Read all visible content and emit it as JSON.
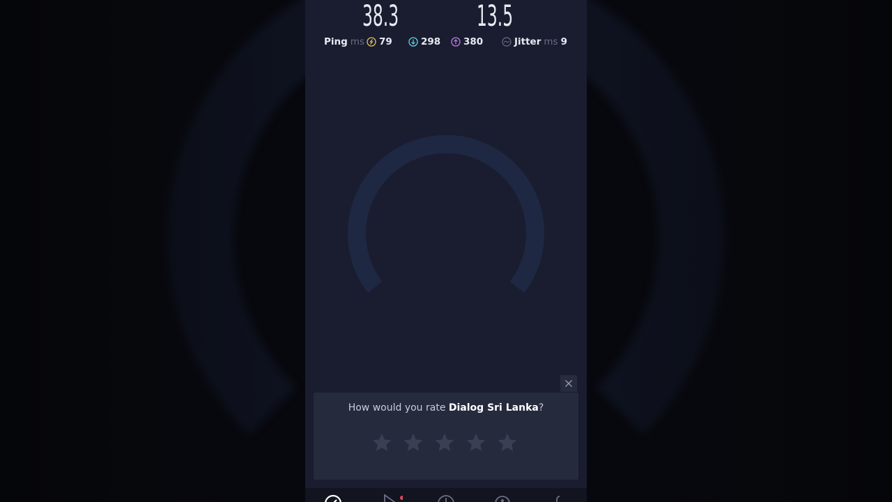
{
  "metrics": {
    "ping_big": "38.3",
    "jitter_big": "13.5",
    "ping_label": "Ping",
    "ping_unit": "ms",
    "idle_ping": "79",
    "download_ping": "298",
    "upload_ping": "380",
    "jitter_label": "Jitter",
    "jitter_unit": "ms",
    "jitter_value": "9"
  },
  "rating": {
    "question_prefix": "How would you rate ",
    "provider": "Dialog Sri Lanka",
    "question_suffix": "?",
    "star_count": 5
  },
  "colors": {
    "background": "#1a1d30",
    "card": "#252a3c",
    "idle_icon": "#e6c15a",
    "download_icon": "#5fd3e6",
    "upload_icon": "#c17be6",
    "notification_dot": "#e8455a"
  },
  "tabs": [
    {
      "icon": "speed-icon",
      "active": true
    },
    {
      "icon": "video-icon",
      "active": false,
      "badge": true
    },
    {
      "icon": "results-icon",
      "active": false
    },
    {
      "icon": "coverage-icon",
      "active": false
    },
    {
      "icon": "settings-icon",
      "active": false
    }
  ]
}
